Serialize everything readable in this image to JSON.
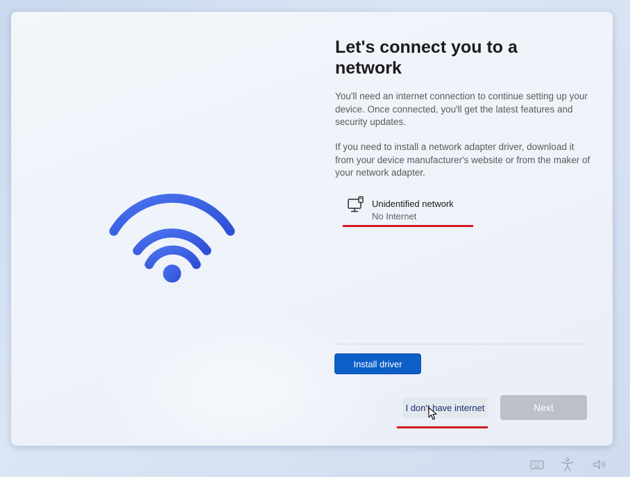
{
  "setup": {
    "title": "Let's connect you to a network",
    "paragraph1": "You'll need an internet connection to continue setting up your device. Once connected, you'll get the latest features and security updates.",
    "paragraph2": "If you need to install a network adapter driver, download it from your device manufacturer's website or from the maker of your network adapter."
  },
  "network": {
    "name": "Unidentified network",
    "status": "No Internet",
    "icon": "wired-network-icon"
  },
  "buttons": {
    "install_driver": "Install driver",
    "no_internet": "I don't have internet",
    "next": "Next"
  },
  "tray": {
    "icons": [
      "keyboard-icon",
      "accessibility-icon",
      "volume-icon"
    ]
  },
  "colors": {
    "accent": "#0c5fc7",
    "wifi": "#3a5ee0",
    "annotation": "#d01a1f",
    "disabled": "#bcc0c7"
  }
}
